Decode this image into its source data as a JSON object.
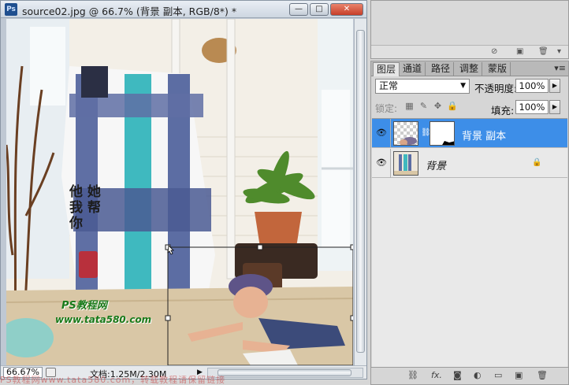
{
  "document": {
    "app_logo": "Ps",
    "title": "source02.jpg @ 66.7% (背景 副本, RGB/8*) *",
    "min_glyph": "—",
    "max_glyph": "□",
    "close_glyph": "✕",
    "zoom": "66.67%",
    "doc_info": "文档:1.25M/2.30M",
    "watermark_url": "www.tata580.com",
    "watermark_site": "PS教程网",
    "watermark_calligraphy": [
      "他",
      "她",
      "我",
      "帮",
      "你"
    ]
  },
  "layers_panel": {
    "tabs": [
      "图层",
      "通道",
      "路径",
      "调整",
      "蒙版"
    ],
    "active_tab": "图层",
    "blend_mode": "正常",
    "opacity_label": "不透明度:",
    "opacity_value": "100%",
    "lock_label": "锁定:",
    "fill_label": "填充:",
    "fill_value": "100%",
    "layers": [
      {
        "name": "背景 副本",
        "selected": true,
        "has_mask": true
      },
      {
        "name": "背景",
        "selected": false,
        "locked": true
      }
    ],
    "footer_icons": [
      "link-icon",
      "fx-icon",
      "add-mask-icon",
      "adjustment-icon",
      "folder-icon",
      "new-layer-icon",
      "trash-icon"
    ]
  },
  "bottom_watermark": "PS教程网www.tata580.com，转载教程请保留链接",
  "colors": {
    "selection": "#3d8ee8",
    "close_button": "#c63f2a"
  }
}
